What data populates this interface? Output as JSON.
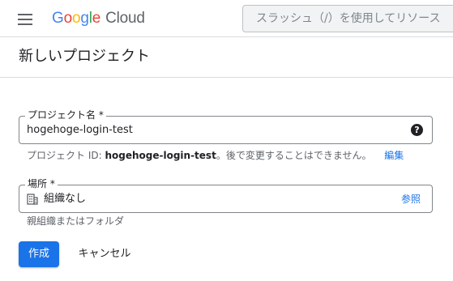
{
  "header": {
    "menu_icon": "hamburger-menu-icon",
    "logo": {
      "google_letters": [
        "G",
        "o",
        "o",
        "g",
        "l",
        "e"
      ],
      "product": "Cloud"
    },
    "search_placeholder": "スラッシュ（/）を使用してリソース"
  },
  "page": {
    "title": "新しいプロジェクト"
  },
  "form": {
    "project_name": {
      "label": "プロジェクト名 *",
      "value": "hogehoge-login-test",
      "help_icon": "help-icon"
    },
    "project_id_hint": {
      "prefix": "プロジェクト ID: ",
      "id": "hogehoge-login-test",
      "suffix": "。後で変更することはできません。",
      "edit_link": "編集"
    },
    "location": {
      "label": "場所 *",
      "icon": "building-icon",
      "value": "組織なし",
      "browse_label": "参照",
      "hint": "親組織またはフォルダ"
    }
  },
  "actions": {
    "create_label": "作成",
    "cancel_label": "キャンセル"
  },
  "colors": {
    "primary": "#1a73e8",
    "border": "#80868b",
    "divider": "#dadce0"
  }
}
